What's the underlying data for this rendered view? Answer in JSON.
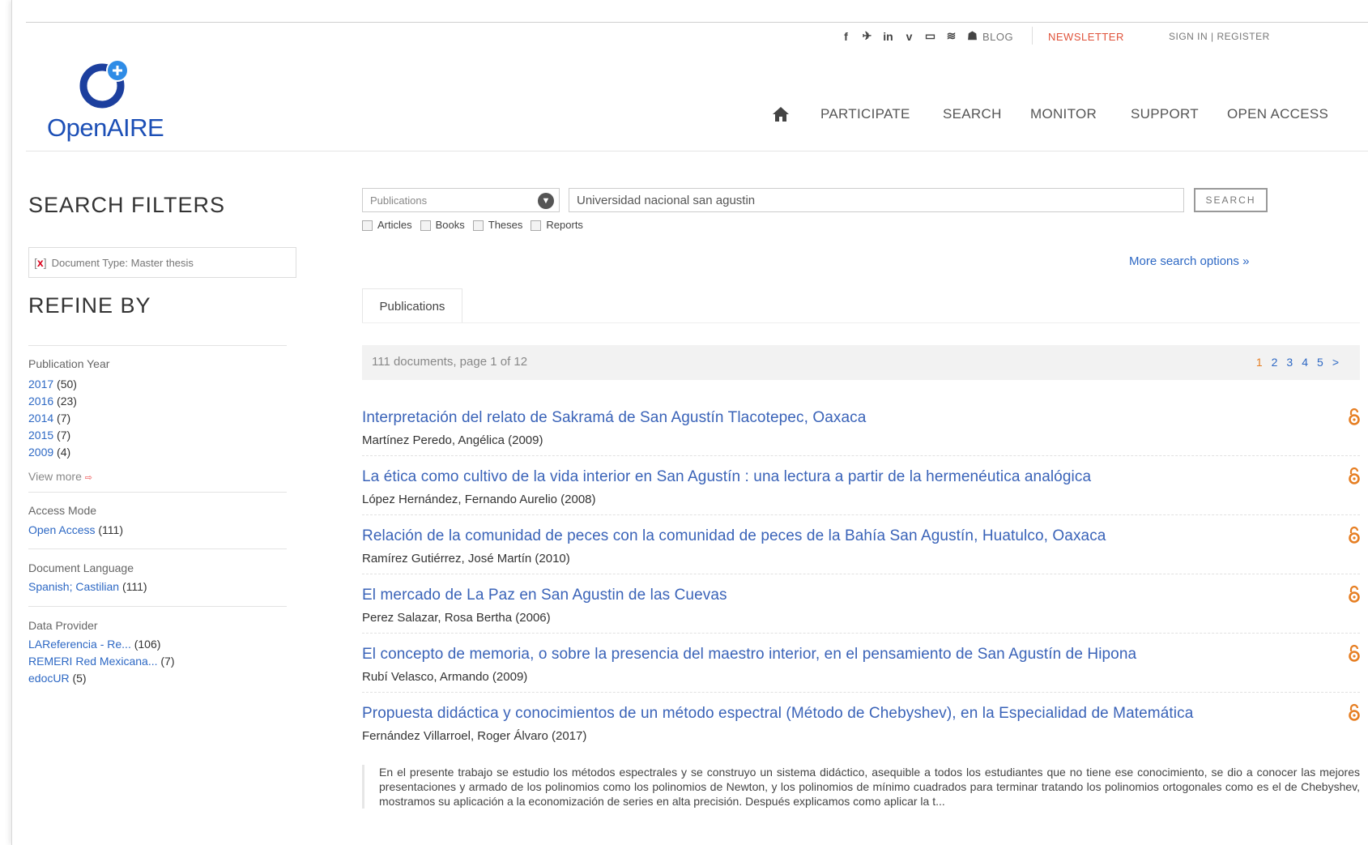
{
  "brand": {
    "logo_text": "OpenAIRE",
    "color_dark": "#1c3f9e",
    "color_light": "#2f8ce6"
  },
  "social_icons": [
    "facebook-icon",
    "twitter-icon",
    "linkedin-icon",
    "vimeo-icon",
    "youtube-icon",
    "rss-icon",
    "news-icon"
  ],
  "social_glyphs": [
    "f",
    "✈",
    "in",
    "v",
    "▭",
    "≋",
    "☗"
  ],
  "top_links": {
    "blog": "BLOG",
    "newsletter": "NEWSLETTER",
    "sign_in": "SIGN IN | REGISTER"
  },
  "nav": {
    "participate": "PARTICIPATE",
    "search": "SEARCH",
    "monitor": "MONITOR",
    "support": "SUPPORT",
    "open_access": "OPEN ACCESS"
  },
  "filters": {
    "heading": "SEARCH FILTERS",
    "remove": "x",
    "active_filter": "Document Type: Master thesis",
    "refine_heading": "REFINE BY"
  },
  "facets": {
    "year": {
      "title": "Publication Year",
      "items": [
        {
          "label": "2017",
          "count": "(50)"
        },
        {
          "label": "2016",
          "count": "(23)"
        },
        {
          "label": "2014",
          "count": "(7)"
        },
        {
          "label": "2015",
          "count": "(7)"
        },
        {
          "label": "2009",
          "count": "(4)"
        }
      ],
      "view_more": "View more"
    },
    "access": {
      "title": "Access Mode",
      "items": [
        {
          "label": "Open Access",
          "count": "(111)"
        }
      ]
    },
    "language": {
      "title": "Document Language",
      "items": [
        {
          "label": "Spanish; Castilian",
          "count": "(111)"
        }
      ]
    },
    "provider": {
      "title": "Data Provider",
      "items": [
        {
          "label": "LAReferencia - Re...",
          "count": "(106)"
        },
        {
          "label": "REMERI Red Mexicana...",
          "count": "(7)"
        },
        {
          "label": "edocUR",
          "count": "(5)"
        }
      ]
    }
  },
  "search": {
    "type": "Publications",
    "query": "Universidad nacional san agustin",
    "button": "SEARCH",
    "checkboxes": [
      "Articles",
      "Books",
      "Theses",
      "Reports"
    ],
    "more_options": "More search options »"
  },
  "tabs": {
    "active": "Publications"
  },
  "results_bar": {
    "info": "111 documents, page 1 of 12",
    "pages": [
      "1",
      "2",
      "3",
      "4",
      "5",
      ">"
    ]
  },
  "results": [
    {
      "title": "Interpretación del relato de Sakramá de San Agustín Tlacotepec, Oaxaca",
      "authors": "Martínez Peredo, Angélica (2009)"
    },
    {
      "title": "La ética como cultivo de la vida interior en San Agustín : una lectura a partir de la hermenéutica analógica",
      "authors": "López Hernández, Fernando Aurelio (2008)"
    },
    {
      "title": "Relación de la comunidad de peces con la comunidad de peces de la Bahía San Agustín, Huatulco, Oaxaca",
      "authors": "Ramírez Gutiérrez, José Martín (2010)"
    },
    {
      "title": "El mercado de La Paz en San Agustin de las Cuevas",
      "authors": "Perez Salazar, Rosa Bertha (2006)"
    },
    {
      "title": "El concepto de memoria, o sobre la presencia del maestro interior, en el pensamiento de San Agustín de Hipona",
      "authors": "Rubí Velasco, Armando (2009)"
    },
    {
      "title": "Propuesta didáctica y conocimientos de un método espectral (Método de Chebyshev), en la Especialidad de Matemática",
      "authors": "Fernández Villarroel, Roger Álvaro (2017)"
    }
  ],
  "abstract": "En el presente trabajo se estudio los métodos espectrales y se construyo un sistema didáctico, asequible a todos los estudiantes que no tiene ese conocimiento, se dio a conocer las mejores presentaciones y armado de los polinomios como los polinomios de Newton, y los polinomios de mínimo cuadrados para terminar tratando los polinomios ortogonales como es el de Chebyshev, mostramos su aplicación a la economización de series en alta precisión. Después explicamos como aplicar la t...",
  "colors": {
    "link": "#2d68c4",
    "title": "#3a63b8",
    "accent_orange": "#e67e22",
    "newsletter": "#e0533b"
  }
}
